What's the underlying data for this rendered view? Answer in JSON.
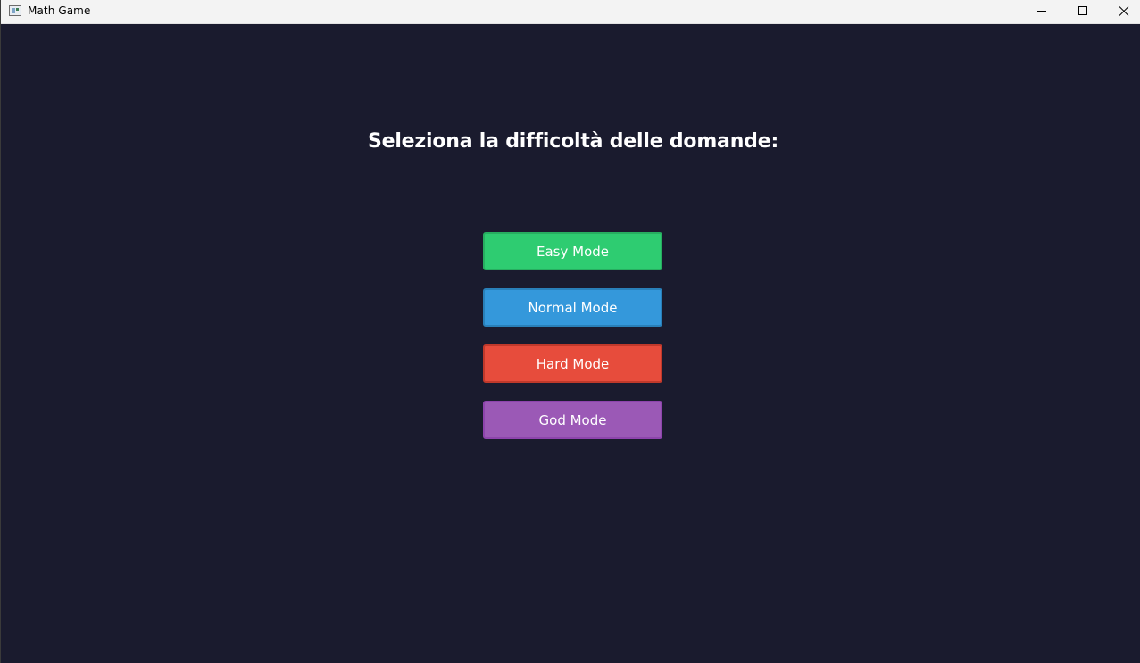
{
  "window": {
    "title": "Math Game"
  },
  "icons": {
    "app": "app-window-icon",
    "minimize": "minimize-icon",
    "maximize": "maximize-icon",
    "close": "close-icon"
  },
  "main": {
    "heading": "Seleziona la difficoltà delle domande:",
    "background_color": "#1a1b2e",
    "buttons": [
      {
        "label": "Easy Mode",
        "color": "#2ecc71"
      },
      {
        "label": "Normal Mode",
        "color": "#3498db"
      },
      {
        "label": "Hard Mode",
        "color": "#e74c3c"
      },
      {
        "label": "God Mode",
        "color": "#9b59b6"
      }
    ]
  }
}
